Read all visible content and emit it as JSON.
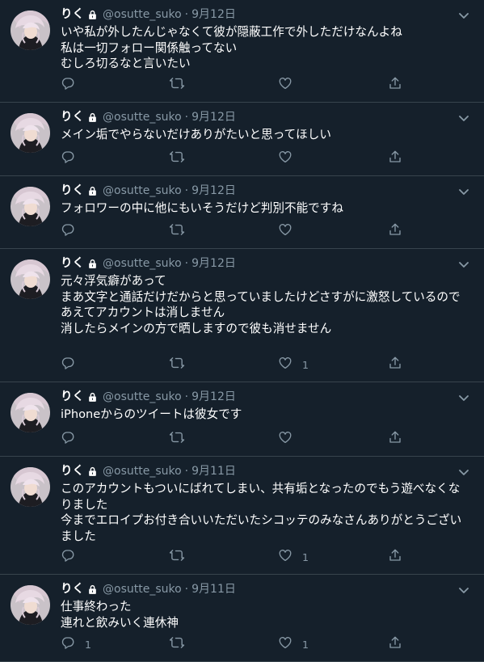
{
  "colors": {
    "background": "#15202b",
    "border": "#38444d",
    "secondary_text": "#8899a6",
    "primary_text": "#ffffff"
  },
  "tweets": [
    {
      "name": "りく",
      "handle": "@osutte_suko",
      "separator": "·",
      "date": "9月12日",
      "lines": [
        "いや私が外したんじゃなくて彼が隠蔽工作で外しただけなんよね",
        "私は一切フォロー関係触ってない",
        "むしろ切るなと言いたい"
      ],
      "reply_count": "",
      "retweet_count": "",
      "like_count": ""
    },
    {
      "name": "りく",
      "handle": "@osutte_suko",
      "separator": "·",
      "date": "9月12日",
      "lines": [
        "メイン垢でやらないだけありがたいと思ってほしい"
      ],
      "reply_count": "",
      "retweet_count": "",
      "like_count": ""
    },
    {
      "name": "りく",
      "handle": "@osutte_suko",
      "separator": "·",
      "date": "9月12日",
      "lines": [
        "フォロワーの中に他にもいそうだけど判別不能ですね"
      ],
      "reply_count": "",
      "retweet_count": "",
      "like_count": ""
    },
    {
      "name": "りく",
      "handle": "@osutte_suko",
      "separator": "·",
      "date": "9月12日",
      "lines": [
        "元々浮気癖があって",
        "まあ文字と通話だけだからと思っていましたけどさすがに激怒しているので",
        "あえてアカウントは消しません",
        "消したらメインの方で晒しますので彼も消せません"
      ],
      "reply_count": "",
      "retweet_count": "",
      "like_count": "1"
    },
    {
      "name": "りく",
      "handle": "@osutte_suko",
      "separator": "·",
      "date": "9月12日",
      "lines": [
        "iPhoneからのツイートは彼女です"
      ],
      "reply_count": "",
      "retweet_count": "",
      "like_count": ""
    },
    {
      "name": "りく",
      "handle": "@osutte_suko",
      "separator": "·",
      "date": "9月11日",
      "lines": [
        "このアカウントもついにばれてしまい、共有垢となったのでもう遊べなくなりました",
        "今までエロイプお付き合いいただいたシコッテのみなさんありがとうございました"
      ],
      "reply_count": "",
      "retweet_count": "",
      "like_count": "1"
    },
    {
      "name": "りく",
      "handle": "@osutte_suko",
      "separator": "·",
      "date": "9月11日",
      "lines": [
        "仕事終わった",
        "連れと飲みいく連休神"
      ],
      "reply_count": "1",
      "retweet_count": "",
      "like_count": "1"
    }
  ]
}
